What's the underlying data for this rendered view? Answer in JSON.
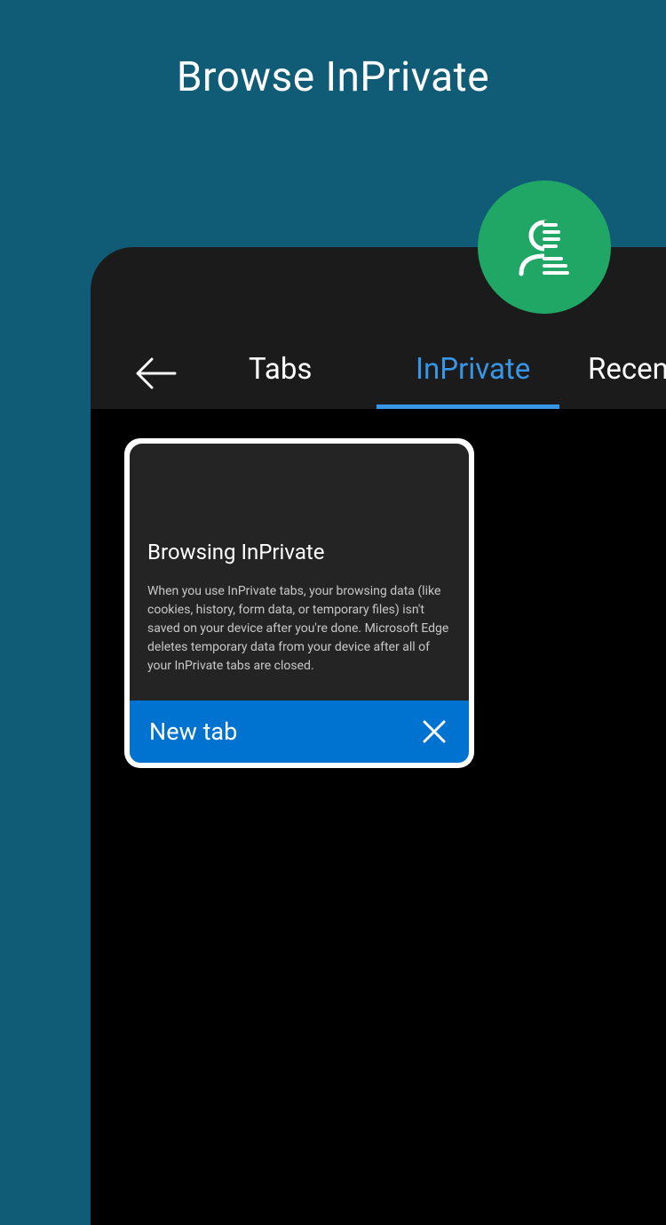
{
  "headline": "Browse InPrivate",
  "header": {
    "tabs": [
      {
        "label": "Tabs",
        "active": false
      },
      {
        "label": "InPrivate",
        "active": true
      },
      {
        "label": "Recen",
        "active": false
      }
    ]
  },
  "card": {
    "title": "Browsing InPrivate",
    "description": "When you use InPrivate tabs, your browsing data (like cookies, history, form data, or temporary files) isn't saved on your device after you're done. Microsoft Edge deletes temporary data from your device after all of your InPrivate tabs are closed.",
    "footer_label": "New tab"
  },
  "colors": {
    "background": "#105b76",
    "badge": "#20a765",
    "accent": "#3896e7",
    "new_tab_bar": "#0073d1"
  },
  "icons": {
    "avatar": "inprivate-person-icon",
    "back": "back-arrow-icon",
    "close": "close-icon"
  }
}
